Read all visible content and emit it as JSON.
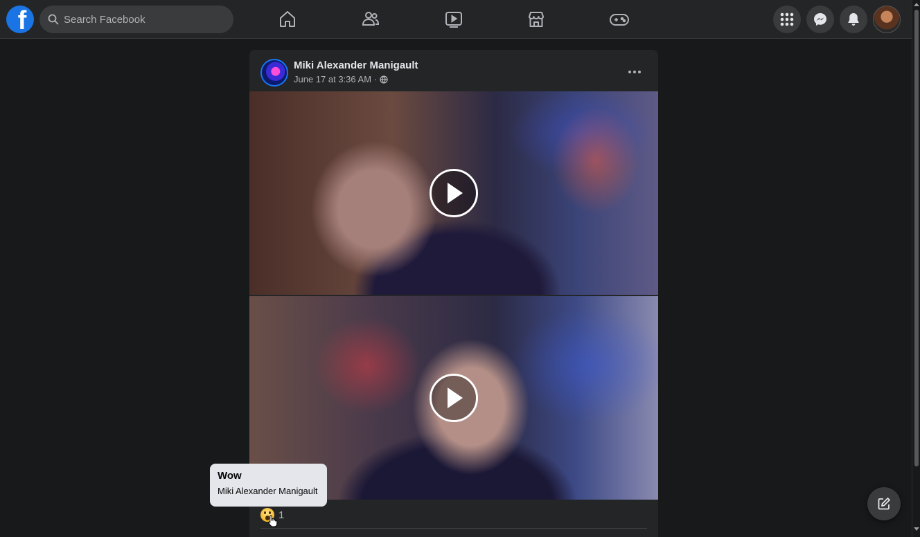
{
  "header": {
    "logo_letter": "f",
    "search_placeholder": "Search Facebook",
    "nav_icons": [
      "home-icon",
      "friends-icon",
      "watch-icon",
      "marketplace-icon",
      "gaming-icon"
    ],
    "right_icons": [
      "menu-grid-icon",
      "messenger-icon",
      "notifications-icon"
    ]
  },
  "post": {
    "author": "Miki Alexander Manigault",
    "timestamp": "June 17 at 3:36 AM",
    "separator": "·",
    "privacy_icon": "globe-icon",
    "reaction_count": "1"
  },
  "tooltip": {
    "title": "Wow",
    "name": "Miki Alexander Manigault"
  },
  "colors": {
    "background": "#18191a",
    "surface": "#242526",
    "accent": "#1877f2",
    "text_primary": "#e4e6eb",
    "text_secondary": "#b0b3b8"
  }
}
